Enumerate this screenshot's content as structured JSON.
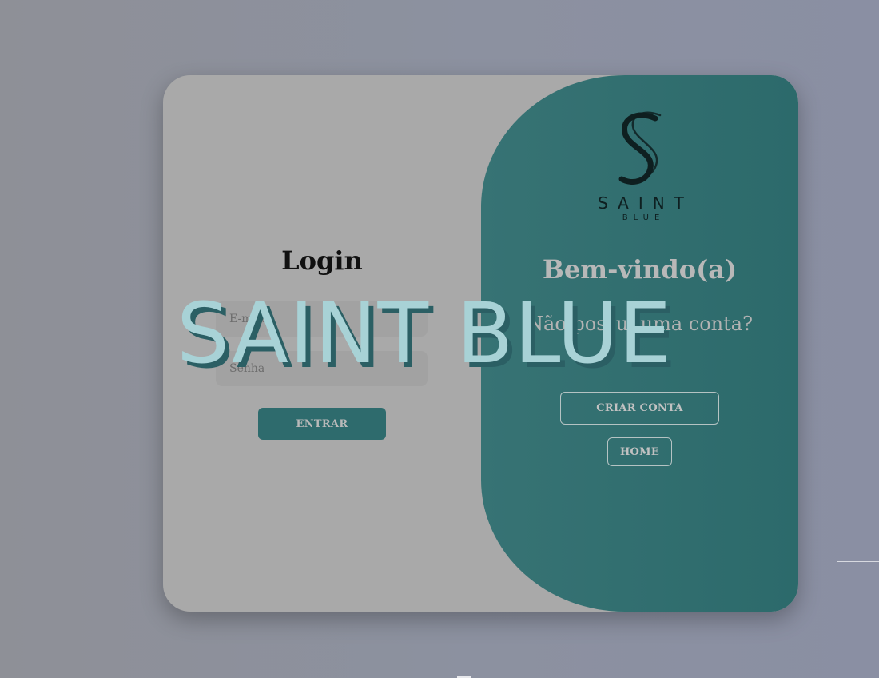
{
  "login": {
    "title": "Login",
    "email_placeholder": "E-mail",
    "password_placeholder": "Senha",
    "submit_label": "ENTRAR"
  },
  "welcome": {
    "logo_word": "SAINT",
    "logo_subword": "BLUE",
    "title": "Bem-vindo(a)",
    "question": "Não possui uma conta?",
    "create_account_label": "CRIAR CONTA",
    "home_label": "HOME"
  },
  "overlay": {
    "text": "SAINT BLUE"
  },
  "colors": {
    "accent_teal": "#2e6b6d",
    "card_gray": "#a9a9a9",
    "overlay_text": "#a8d2d6",
    "overlay_shadow": "#2b5f64"
  },
  "icons": {
    "logo": "saint-blue-s-logo"
  }
}
